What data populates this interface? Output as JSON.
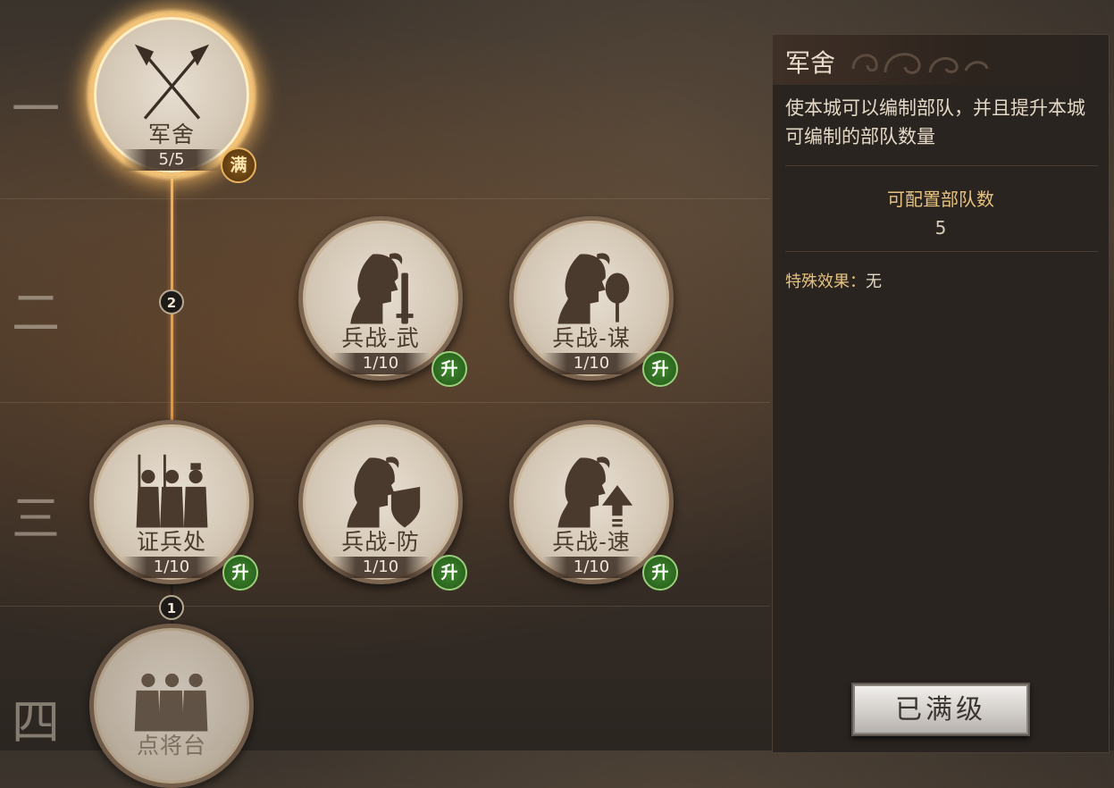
{
  "tiers": [
    "一",
    "二",
    "三",
    "四"
  ],
  "connectors": {
    "req_tier2": "2",
    "req_tier4": "1"
  },
  "nodes": [
    {
      "id": "barracks",
      "name": "军舍",
      "level": "5/5",
      "badge": "满",
      "icon": "crossed-spears-icon",
      "state": "maxed"
    },
    {
      "id": "war-might",
      "name": "兵战-武",
      "level": "1/10",
      "badge": "升",
      "icon": "soldier-sword-icon",
      "state": "upgradable"
    },
    {
      "id": "war-strategy",
      "name": "兵战-谋",
      "level": "1/10",
      "badge": "升",
      "icon": "soldier-fan-icon",
      "state": "upgradable"
    },
    {
      "id": "recruit-office",
      "name": "证兵处",
      "level": "1/10",
      "badge": "升",
      "icon": "spearmen-group-icon",
      "state": "upgradable"
    },
    {
      "id": "war-defense",
      "name": "兵战-防",
      "level": "1/10",
      "badge": "升",
      "icon": "soldier-shield-icon",
      "state": "upgradable"
    },
    {
      "id": "war-speed",
      "name": "兵战-速",
      "level": "1/10",
      "badge": "升",
      "icon": "soldier-arrow-up-icon",
      "state": "upgradable"
    },
    {
      "id": "general-platform",
      "name": "点将台",
      "icon": "generals-group-icon",
      "state": "locked"
    }
  ],
  "panel": {
    "title": "军舍",
    "description": "使本城可以编制部队，并且提升本城可编制的部队数量",
    "stat_label": "可配置部队数",
    "stat_value": "5",
    "special_label": "特殊效果：",
    "special_value": "无",
    "button": "已满级"
  },
  "colors": {
    "maxed_glow": "#f2c277",
    "connector_active": "#e29436",
    "upgrade_badge": "#3f8a2c",
    "full_badge": "#8a5a1c",
    "label_gold": "#e7c27f"
  }
}
